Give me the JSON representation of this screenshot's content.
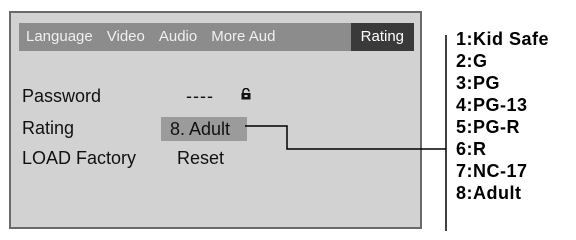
{
  "tabs": [
    {
      "label": "Language"
    },
    {
      "label": "Video"
    },
    {
      "label": "Audio"
    },
    {
      "label": "More Aud"
    },
    {
      "label": "Rating"
    }
  ],
  "settings": {
    "password": {
      "label": "Password",
      "value": "----",
      "icon": "lock-icon"
    },
    "rating": {
      "label": "Rating",
      "value": "8. Adult"
    },
    "load_factory": {
      "label": "LOAD Factory",
      "value": "Reset"
    }
  },
  "rating_options": [
    "1:Kid Safe",
    "2:G",
    "3:PG",
    "4:PG-13",
    "5:PG-R",
    "6:R",
    "7:NC-17",
    "8:Adult"
  ],
  "colors": {
    "panel": "#d2d2d2",
    "tabbar": "#8c8c8c",
    "active_tab": "#3a3a3a",
    "highlight": "#9b9b9b"
  }
}
